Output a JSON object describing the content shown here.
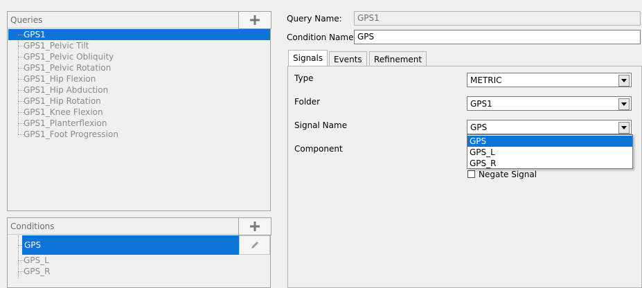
{
  "queries": {
    "title": "Queries",
    "add_icon": "plus-icon",
    "items": [
      "GPS1",
      "GPS1_Pelvic Tilt",
      "GPS1_Pelvic Obliquity",
      "GPS1_Pelvic Rotation",
      "GPS1_Hip Flexion",
      "GPS1_Hip Abduction",
      "GPS1_Hip Rotation",
      "GPS1_Knee Flexion",
      "GPS1_Planterflexion",
      "GPS1_Foot Progression"
    ],
    "selected": "GPS1"
  },
  "conditions": {
    "title": "Conditions",
    "add_icon": "plus-icon",
    "edit_icon": "pencil-icon",
    "items": [
      "GPS",
      "GPS_L",
      "GPS_R"
    ],
    "selected": "GPS"
  },
  "form": {
    "query_name_label": "Query Name:",
    "query_name_value": "GPS1",
    "condition_name_label": "Condition Name:",
    "condition_name_value": "GPS"
  },
  "tabs": [
    "Signals",
    "Events",
    "Refinement"
  ],
  "active_tab": "Signals",
  "signals": {
    "type_label": "Type",
    "type_value": "METRIC",
    "folder_label": "Folder",
    "folder_value": "GPS1",
    "signal_name_label": "Signal Name",
    "signal_name_value": "GPS",
    "component_label": "Component",
    "signal_options": [
      "GPS",
      "GPS_L",
      "GPS_R"
    ],
    "negate_label": "Negate Signal",
    "negate_checked": false
  },
  "colors": {
    "selection": "#0a74d9",
    "background": "#f0f0f0"
  }
}
